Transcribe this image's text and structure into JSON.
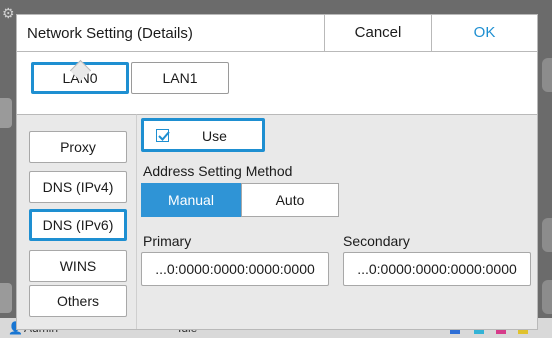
{
  "dialog": {
    "title": "Network Setting (Details)",
    "cancel_label": "Cancel",
    "ok_label": "OK"
  },
  "lan_tabs": [
    {
      "label": "LAN0",
      "selected": true
    },
    {
      "label": "LAN1",
      "selected": false
    }
  ],
  "nav": [
    {
      "label": "Proxy",
      "selected": false
    },
    {
      "label": "DNS (IPv4)",
      "selected": false
    },
    {
      "label": "DNS (IPv6)",
      "selected": true
    },
    {
      "label": "WINS",
      "selected": false
    },
    {
      "label": "Others",
      "selected": false
    }
  ],
  "use": {
    "label": "Use",
    "checked": true
  },
  "address_method": {
    "label": "Address Setting Method",
    "options": [
      "Manual",
      "Auto"
    ],
    "selected": "Manual"
  },
  "primary": {
    "label": "Primary",
    "value": "...0:0000:0000:0000:0000"
  },
  "secondary": {
    "label": "Secondary",
    "value": "...0:0000:0000:0000:0000"
  },
  "status_bar": {
    "user": "Admin",
    "status": "Idle"
  },
  "colors": {
    "accent": "#1e8fd1",
    "selected_fill": "#2f94d6",
    "panel": "#e9e9e9"
  }
}
